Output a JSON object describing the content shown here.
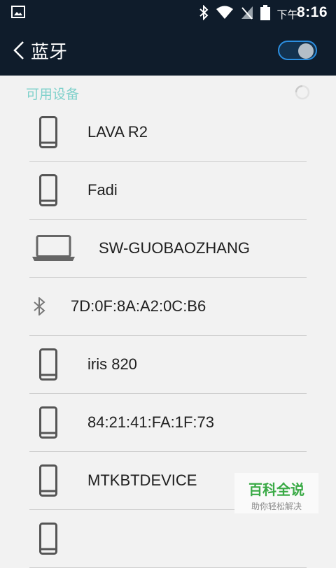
{
  "status_bar": {
    "ampm": "下午",
    "time": "8:16",
    "icons": [
      "gallery-icon",
      "bluetooth-icon",
      "wifi-icon",
      "no-signal-icon",
      "battery-icon"
    ]
  },
  "app_bar": {
    "title": "蓝牙",
    "bluetooth_enabled": true
  },
  "section": {
    "title": "可用设备",
    "scanning": true
  },
  "devices": [
    {
      "type": "phone",
      "icon": "phone-icon",
      "name": "LAVA R2"
    },
    {
      "type": "phone",
      "icon": "phone-icon",
      "name": "Fadi"
    },
    {
      "type": "laptop",
      "icon": "laptop-icon",
      "name": "SW-GUOBAOZHANG"
    },
    {
      "type": "bluetooth",
      "icon": "bluetooth-icon",
      "name": "7D:0F:8A:A2:0C:B6"
    },
    {
      "type": "phone",
      "icon": "phone-icon",
      "name": "iris 820"
    },
    {
      "type": "phone",
      "icon": "phone-icon",
      "name": "84:21:41:FA:1F:73"
    },
    {
      "type": "phone",
      "icon": "phone-icon",
      "name": "MTKBTDEVICE"
    },
    {
      "type": "phone",
      "icon": "phone-icon",
      "name": ""
    }
  ],
  "watermark": {
    "main": "百科全说",
    "sub": "助你轻松解决"
  },
  "colors": {
    "header_bg": "#0f1c2b",
    "toggle_accent": "#2c8fe0",
    "section_text": "#7fd1cb",
    "page_bg": "#f2f2f2",
    "watermark_green": "#3aaa46"
  }
}
